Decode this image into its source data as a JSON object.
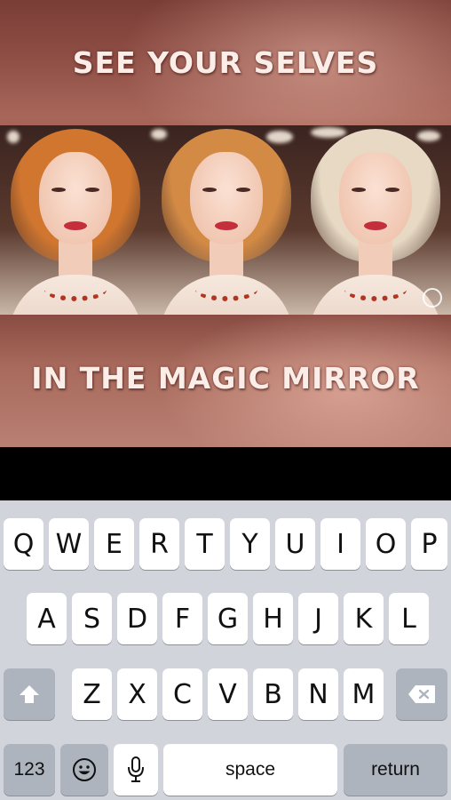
{
  "promo": {
    "headline_top": "SEE YOUR SELVES",
    "headline_bottom": "IN THE MAGIC MIRROR",
    "portraits": [
      {
        "hair_color": "#d0762f"
      },
      {
        "hair_color": "#d38a45"
      },
      {
        "hair_color": "#e7d9c4"
      }
    ]
  },
  "keyboard": {
    "row1": [
      "Q",
      "W",
      "E",
      "R",
      "T",
      "Y",
      "U",
      "I",
      "O",
      "P"
    ],
    "row2": [
      "A",
      "S",
      "D",
      "F",
      "G",
      "H",
      "J",
      "K",
      "L"
    ],
    "row3": [
      "Z",
      "X",
      "C",
      "V",
      "B",
      "N",
      "M"
    ],
    "shift_icon": "shift-arrow-icon",
    "delete_icon": "delete-backspace-icon",
    "numbers_label": "123",
    "emoji_icon": "emoji-face-icon",
    "mic_icon": "microphone-icon",
    "space_label": "space",
    "return_label": "return"
  },
  "colors": {
    "keyboard_bg": "#d1d5db",
    "key_light": "#ffffff",
    "key_dark": "#adb4be",
    "headline": "#fbeee8"
  }
}
